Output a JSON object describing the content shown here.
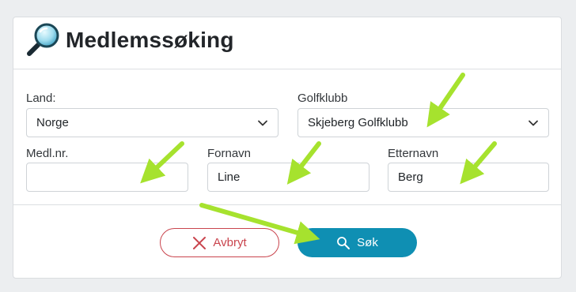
{
  "header": {
    "title": "Medlemssøking",
    "icon": "magnifier-icon"
  },
  "form": {
    "land": {
      "label": "Land:",
      "value": "Norge"
    },
    "golfklubb": {
      "label": "Golfklubb",
      "value": "Skjeberg Golfklubb"
    },
    "medlnr": {
      "label": "Medl.nr.",
      "value": ""
    },
    "fornavn": {
      "label": "Fornavn",
      "value": "Line"
    },
    "etternavn": {
      "label": "Etternavn",
      "value": "Berg"
    }
  },
  "buttons": {
    "cancel_label": "Avbryt",
    "search_label": "Søk"
  },
  "colors": {
    "accent": "#0f8fb3",
    "cancel": "#c9444d",
    "arrow": "#a6e22e"
  }
}
